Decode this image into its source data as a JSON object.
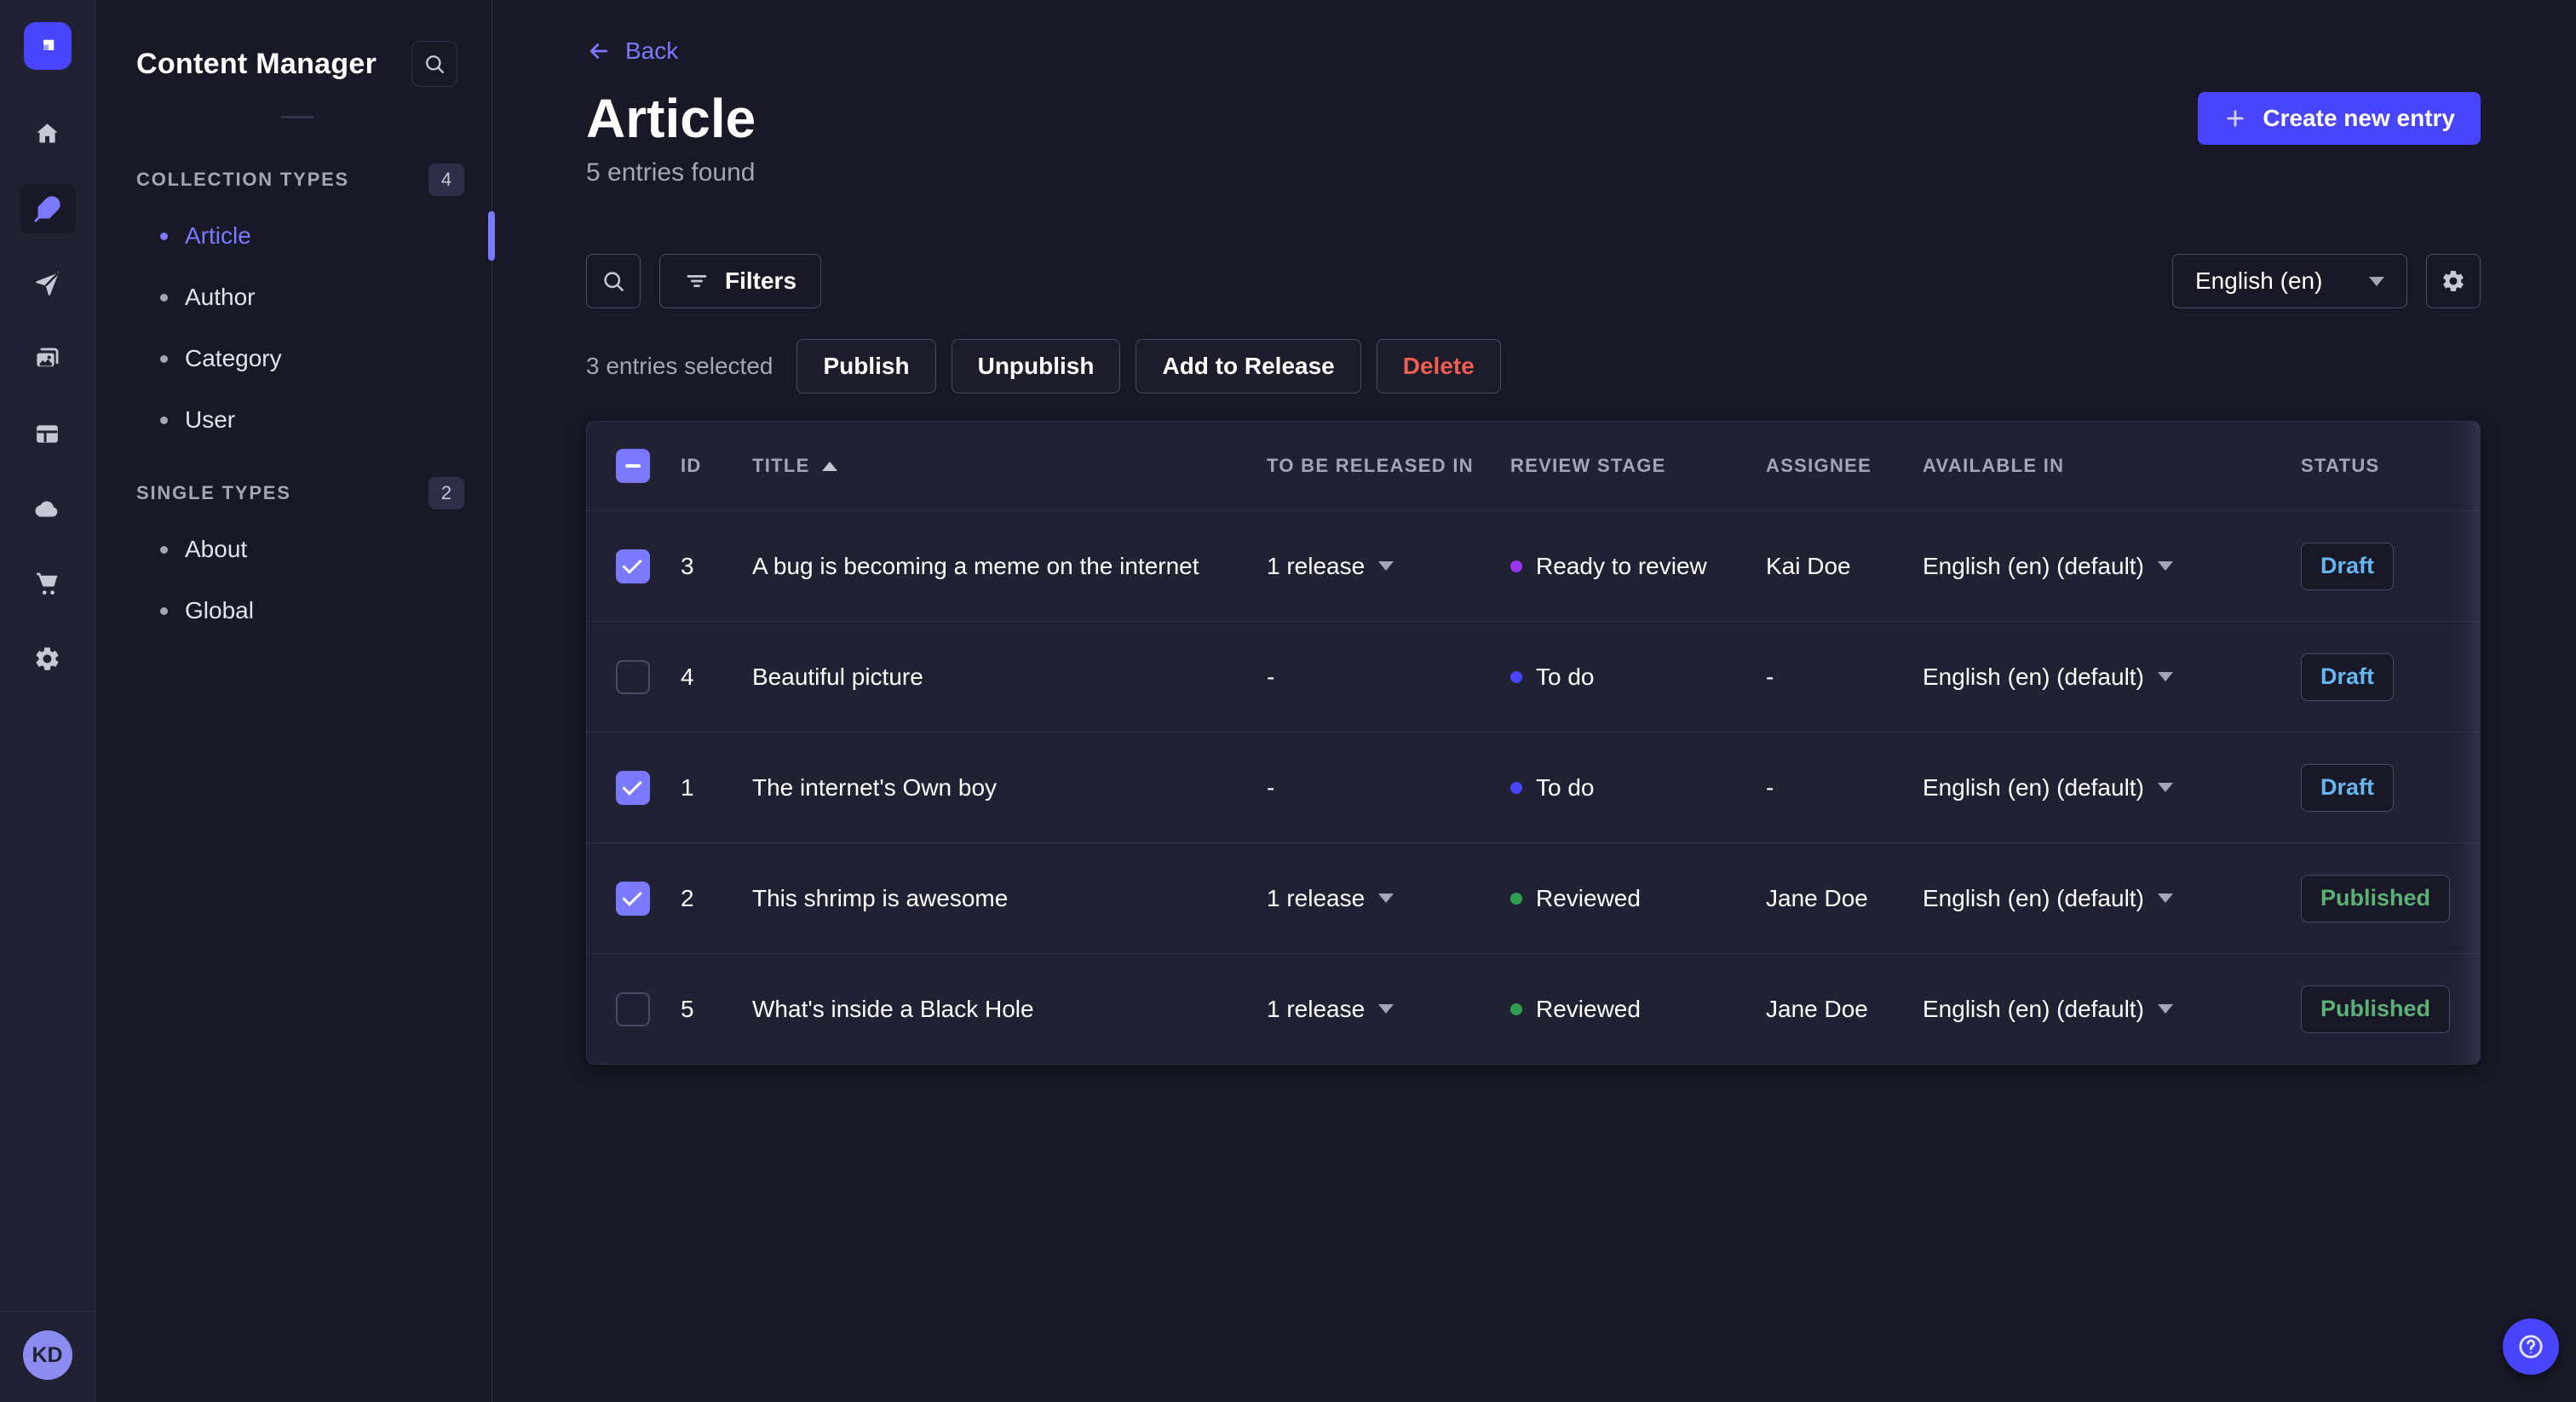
{
  "rail": {
    "icons": [
      "home",
      "content-manager",
      "releases",
      "media-library",
      "content-type-builder",
      "cloud",
      "marketplace",
      "settings"
    ],
    "avatar_initials": "KD"
  },
  "subnav": {
    "title": "Content Manager",
    "collection_types": {
      "label": "COLLECTION TYPES",
      "count": "4",
      "items": [
        {
          "label": "Article",
          "active": true
        },
        {
          "label": "Author",
          "active": false
        },
        {
          "label": "Category",
          "active": false
        },
        {
          "label": "User",
          "active": false
        }
      ]
    },
    "single_types": {
      "label": "SINGLE TYPES",
      "count": "2",
      "items": [
        {
          "label": "About",
          "active": false
        },
        {
          "label": "Global",
          "active": false
        }
      ]
    }
  },
  "header": {
    "back_label": "Back",
    "title": "Article",
    "subtitle": "5 entries found",
    "create_button_label": "Create new entry"
  },
  "toolbar": {
    "filters_label": "Filters",
    "locale_value": "English (en)"
  },
  "selection": {
    "text": "3 entries selected",
    "publish_label": "Publish",
    "unpublish_label": "Unpublish",
    "add_to_release_label": "Add to Release",
    "delete_label": "Delete"
  },
  "table": {
    "columns": {
      "id": "ID",
      "title": "TITLE",
      "released": "TO BE RELEASED IN",
      "review_stage": "REVIEW STAGE",
      "assignee": "ASSIGNEE",
      "available_in": "AVAILABLE IN",
      "status": "STATUS"
    },
    "rows": [
      {
        "checked": true,
        "id": "3",
        "title": "A bug is becoming a meme on the internet",
        "released": "1 release",
        "has_release": true,
        "stage": "Ready to review",
        "stage_color": "#9736e8",
        "assignee": "Kai Doe",
        "available_in": "English (en) (default)",
        "status": "Draft",
        "status_type": "draft"
      },
      {
        "checked": false,
        "id": "4",
        "title": "Beautiful picture",
        "released": "-",
        "has_release": false,
        "stage": "To do",
        "stage_color": "#4945ff",
        "assignee": "-",
        "available_in": "English (en) (default)",
        "status": "Draft",
        "status_type": "draft"
      },
      {
        "checked": true,
        "id": "1",
        "title": "The internet's Own boy",
        "released": "-",
        "has_release": false,
        "stage": "To do",
        "stage_color": "#4945ff",
        "assignee": "-",
        "available_in": "English (en) (default)",
        "status": "Draft",
        "status_type": "draft"
      },
      {
        "checked": true,
        "id": "2",
        "title": "This shrimp is awesome",
        "released": "1 release",
        "has_release": true,
        "stage": "Reviewed",
        "stage_color": "#2f9e4e",
        "assignee": "Jane Doe",
        "available_in": "English (en) (default)",
        "status": "Published",
        "status_type": "published"
      },
      {
        "checked": false,
        "id": "5",
        "title": "What's inside a Black Hole",
        "released": "1 release",
        "has_release": true,
        "stage": "Reviewed",
        "stage_color": "#2f9e4e",
        "assignee": "Jane Doe",
        "available_in": "English (en) (default)",
        "status": "Published",
        "status_type": "published"
      }
    ]
  },
  "colors": {
    "primary": "#4945ff",
    "primary_light": "#7b79ff",
    "danger": "#ee5e52",
    "draft_text": "#66b7f1",
    "published_text": "#5cb176",
    "stage_todo": "#4945ff",
    "stage_ready_to_review": "#9736e8",
    "stage_reviewed": "#2f9e4e"
  }
}
